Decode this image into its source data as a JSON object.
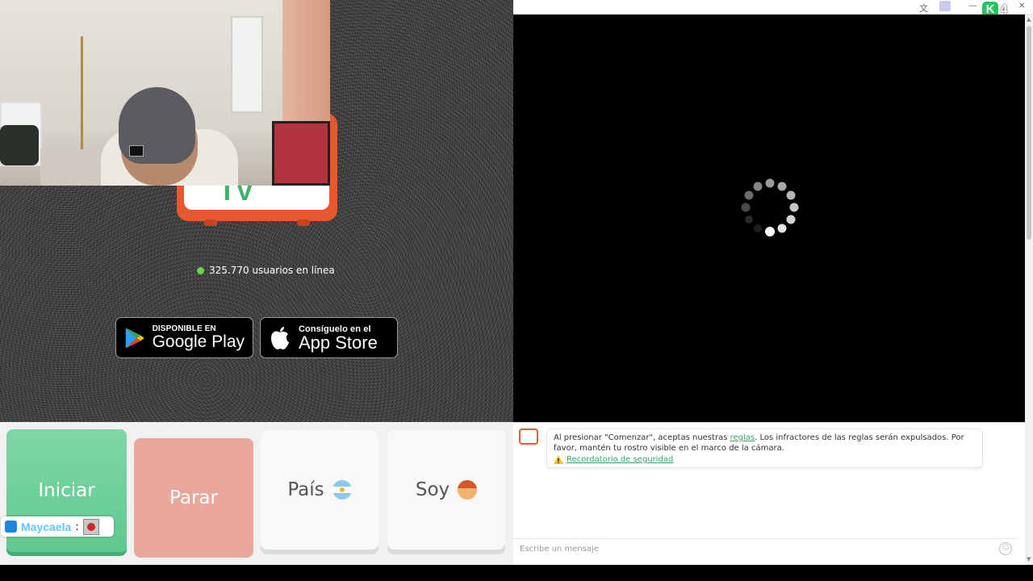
{
  "window": {
    "translate_icon": "translate-icon",
    "menu_icon": "menu-icon",
    "minimize_glyph": "—",
    "close_glyph": "✕",
    "badge_letter": "K",
    "badge_count": "4"
  },
  "site": {
    "logo_text": "TV",
    "users_online": "325.770 usuarios en línea"
  },
  "stores": {
    "google_small": "DISPONIBLE EN",
    "google_big": "Google Play",
    "apple_small": "Consíguelo en el",
    "apple_big": "App Store"
  },
  "controls": {
    "start_label": "Iniciar",
    "stop_label": "Parar",
    "country_label": "País",
    "soy_label": "Soy"
  },
  "overlay": {
    "username": "Maycaela",
    "separator": ":"
  },
  "chat": {
    "notice_pre": "Al presionar \"Comenzar\", aceptas nuestras ",
    "notice_link": "reglas",
    "notice_post": ". Los infractores de las reglas serán expulsados. Por favor, mantén tu rostro visible en el marco de la cámara.",
    "safety_link": "Recordatorio de seguridad",
    "input_placeholder": "Escribe un mensaje"
  },
  "colors": {
    "start_green": "#5fc98f",
    "stop_salmon": "#e9a89b",
    "brand_orange": "#e8582f",
    "online_green": "#6fd24b"
  }
}
